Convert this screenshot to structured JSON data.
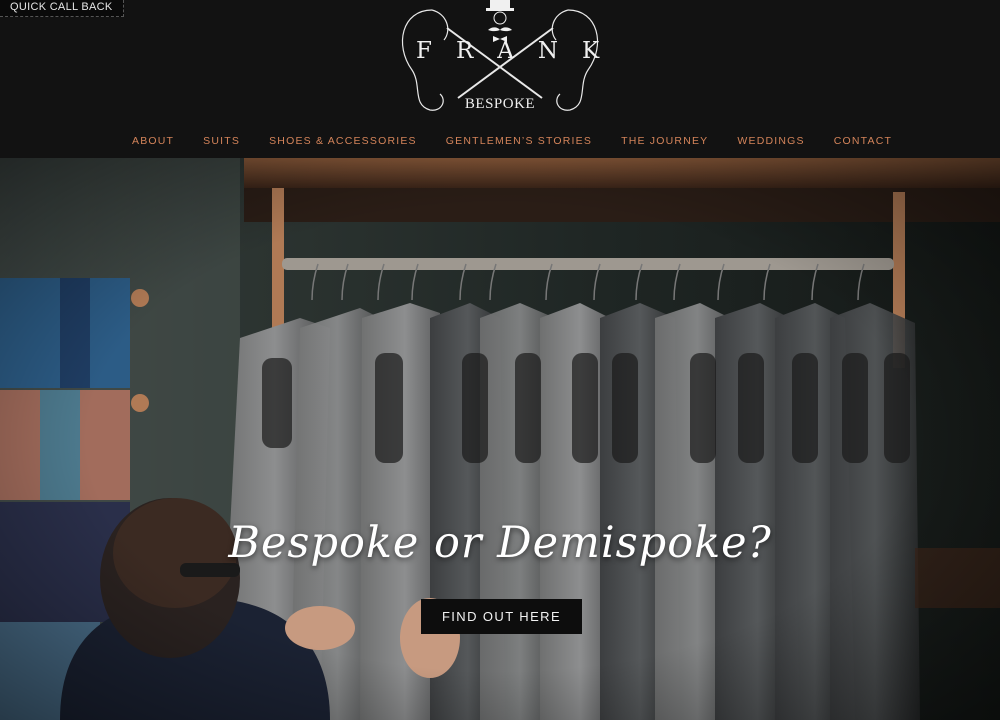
{
  "header": {
    "quick_call": "QUICK CALL BACK",
    "logo": {
      "name": "FRANK",
      "tagline": "BESPOKE"
    }
  },
  "nav": {
    "items": [
      {
        "label": "ABOUT"
      },
      {
        "label": "SUITS"
      },
      {
        "label": "SHOES & ACCESSORIES"
      },
      {
        "label": "GENTLEMEN’S STORIES"
      },
      {
        "label": "THE JOURNEY"
      },
      {
        "label": "WEDDINGS"
      },
      {
        "label": "CONTACT"
      }
    ]
  },
  "hero": {
    "title": "Bespoke or Demispoke?",
    "cta": "FIND OUT HERE"
  },
  "colors": {
    "nav_text": "#d4845a",
    "header_bg": "#121212",
    "cta_bg": "#0d0d0d"
  }
}
